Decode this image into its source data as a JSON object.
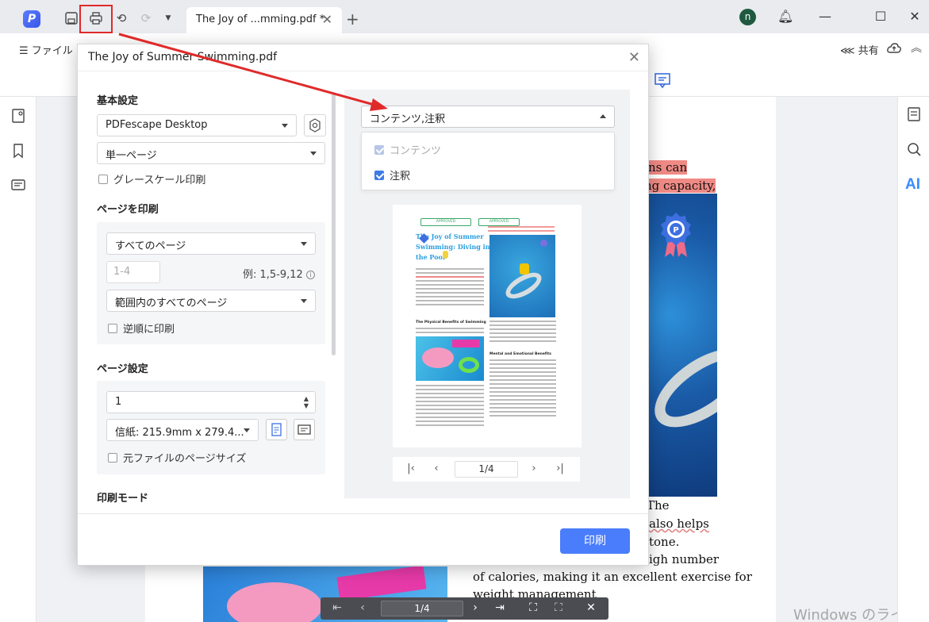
{
  "titlebar": {
    "tab_title": "The Joy of ...mming.pdf *",
    "avatar_letter": "n"
  },
  "menubar": {
    "file_label": "ファイル",
    "share_label": "共有"
  },
  "document": {
    "lines": [
      {
        "text": "ns can",
        "highlighted": true
      },
      {
        "text": "ng capacity,",
        "highlighted": true,
        "suffix": ","
      },
      {
        "text": "The",
        "highlighted": false
      },
      {
        "text": "also helps",
        "highlighted": false
      },
      {
        "text": "tone.",
        "highlighted": false
      },
      {
        "text": "igh number",
        "highlighted": false
      },
      {
        "text": "of calories, making it an excellent exercise for",
        "highlighted": false
      },
      {
        "text": "weight management",
        "highlighted": false
      }
    ],
    "page_indicator": "1/4"
  },
  "watermark": "Windows のライセン",
  "dialog": {
    "title": "The Joy of Summer Swimming.pdf",
    "basic_settings": {
      "title": "基本設定",
      "printer": "PDFescape Desktop",
      "page_mode": "単一ページ",
      "grayscale_label": "グレースケール印刷",
      "grayscale_checked": false
    },
    "pages_to_print": {
      "title": "ページを印刷",
      "range": "すべてのページ",
      "range_input_placeholder": "1-4",
      "example": "例: 1,5-9,12",
      "subset": "範囲内のすべてのページ",
      "reverse_label": "逆順に印刷",
      "reverse_checked": false
    },
    "page_setup": {
      "title": "ページ設定",
      "copies": "1",
      "paper": "信紙: 215.9mm x 279.4...",
      "original_size_label": "元ファイルのページサイズ",
      "original_size_checked": false
    },
    "print_mode": {
      "title": "印刷モード"
    },
    "content_select": {
      "value": "コンテンツ,注釈",
      "options": [
        {
          "label": "コンテンツ",
          "checked": true,
          "disabled": true
        },
        {
          "label": "注釈",
          "checked": true,
          "disabled": false
        }
      ]
    },
    "preview": {
      "stamp_left": "APPROVED",
      "stamp_right": "APPROVED",
      "title_line1": "The Joy of Summer",
      "title_line2": "Swimming: Diving into",
      "title_line3": "the Pool",
      "heading_physical": "The Physical Benefits of Swimming",
      "heading_mental": "Mental and Emotional Benefits",
      "page_indicator": "1/4"
    },
    "print_button": "印刷"
  },
  "colors": {
    "accent": "#4a7dfb",
    "annotation_red": "#e02a2a",
    "highlight": "#f08a85"
  }
}
